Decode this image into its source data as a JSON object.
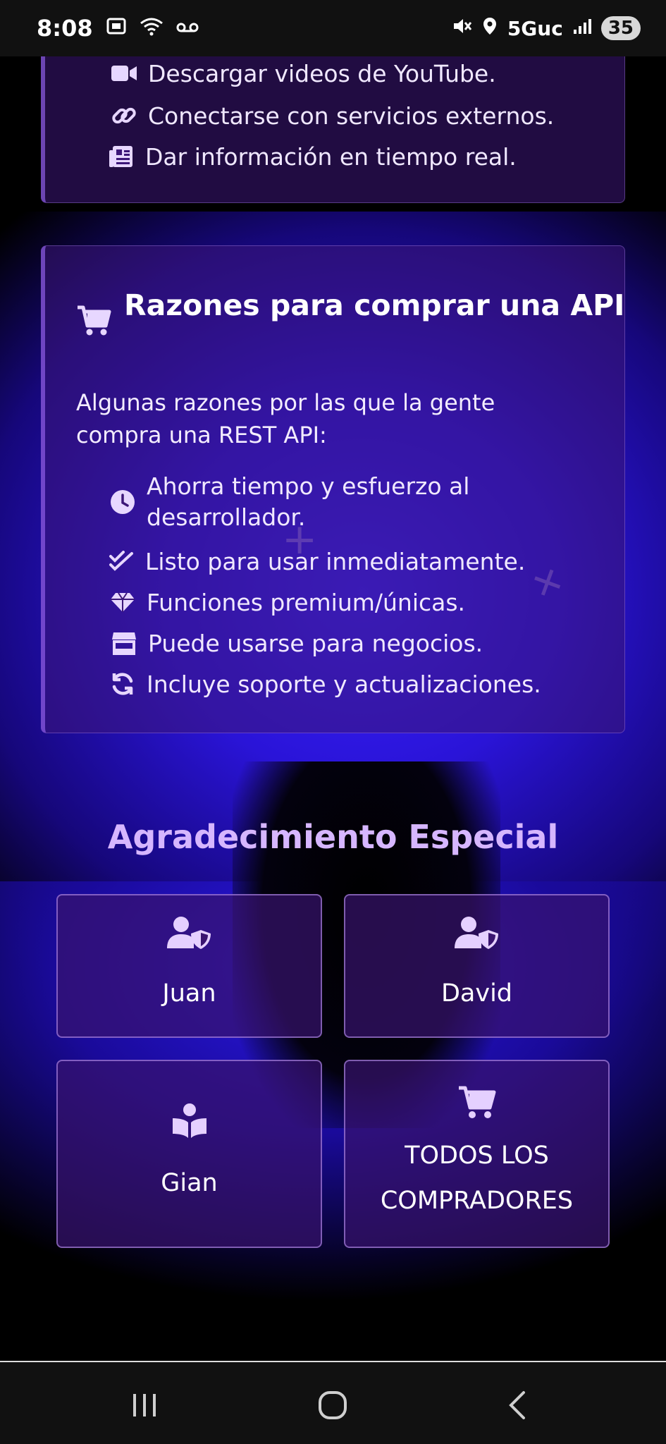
{
  "status_bar": {
    "time": "8:08",
    "network": "5Guc",
    "battery": "35"
  },
  "features_card": {
    "items": [
      {
        "icon": "video-icon",
        "label": "Descargar videos de YouTube."
      },
      {
        "icon": "link-icon",
        "label": "Conectarse con servicios externos."
      },
      {
        "icon": "newspaper-icon",
        "label": "Dar información en tiempo real."
      }
    ]
  },
  "reasons_card": {
    "title": "Razones para comprar una API",
    "intro": "Algunas razones por las que la gente compra una REST API:",
    "items": [
      {
        "icon": "clock-icon",
        "label": "Ahorra tiempo y esfuerzo al desarrollador."
      },
      {
        "icon": "double-check-icon",
        "label": "Listo para usar inmediatamente."
      },
      {
        "icon": "gem-icon",
        "label": "Funciones premium/únicas."
      },
      {
        "icon": "store-icon",
        "label": "Puede usarse para negocios."
      },
      {
        "icon": "sync-icon",
        "label": "Incluye soporte y actualizaciones."
      }
    ]
  },
  "thanks": {
    "title": "Agradecimiento Especial",
    "tiles": [
      {
        "icon": "user-shield-icon",
        "label": "Juan"
      },
      {
        "icon": "user-shield-icon",
        "label": "David"
      },
      {
        "icon": "book-reader-icon",
        "label": "Gian"
      },
      {
        "icon": "cart-icon",
        "label": "TODOS LOS COMPRADORES"
      }
    ]
  },
  "colors": {
    "accent": "#d6b6ff",
    "card_bg": "#3c1678",
    "background_blue": "#2a14d8"
  }
}
